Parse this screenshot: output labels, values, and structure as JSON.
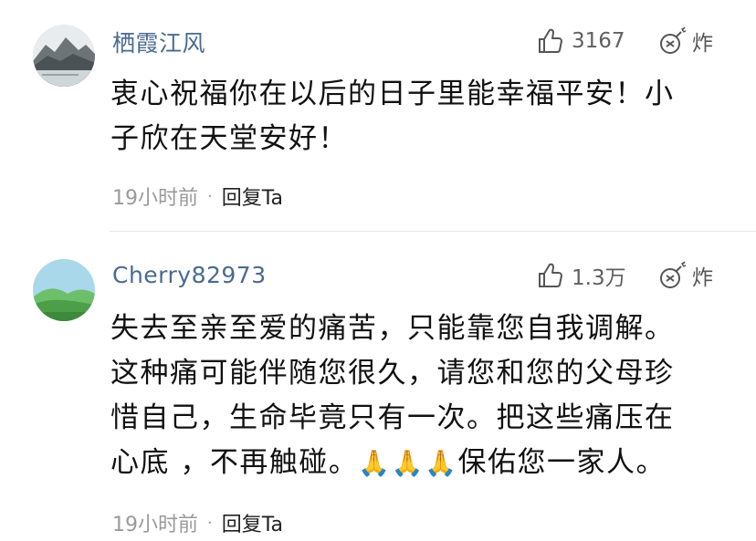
{
  "comments": [
    {
      "username": "栖霞江风",
      "likes": "3167",
      "bomb_label": "炸",
      "text": "衷心祝福你在以后的日子里能幸福平安！小\n子欣在天堂安好！",
      "time": "19小时前",
      "separator": "·",
      "reply_label": "回复Ta"
    },
    {
      "username": "Cherry82973",
      "likes": "1.3万",
      "bomb_label": "炸",
      "text_before_emoji": "失去至亲至爱的痛苦，只能靠您自我调解。\n这种痛可能伴随您很久，请您和您的父母珍\n惜自己，生命毕竟只有一次。把这些痛压在\n心底 ，不再触碰。",
      "emoji": "🙏🙏🙏",
      "text_after_emoji": "保佑您一家人。",
      "time": "19小时前",
      "separator": "·",
      "reply_label": "回复Ta"
    }
  ],
  "icons": {
    "like": "thumbs-up-icon",
    "bomb": "bomb-icon"
  },
  "colors": {
    "username": "#4a6a90",
    "meta": "#9a9a9a",
    "text": "#111111"
  }
}
